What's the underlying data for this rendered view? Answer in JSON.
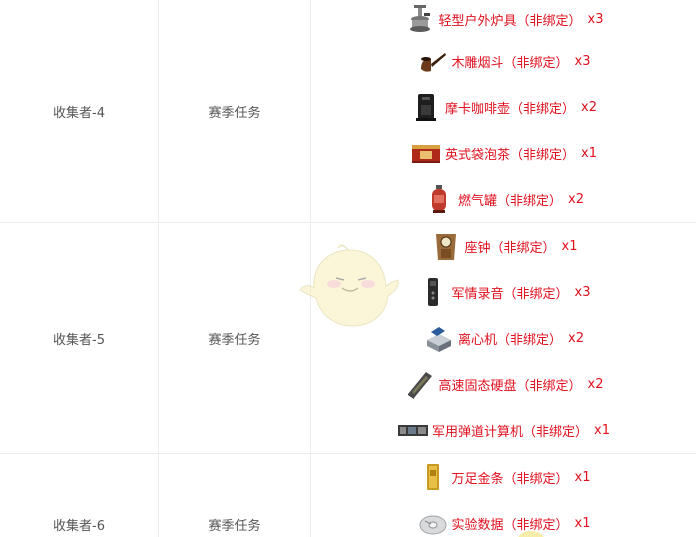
{
  "rows": [
    {
      "name": "收集者-4",
      "type": "赛季任务",
      "rewards": [
        {
          "item": "轻型户外炉具（非绑定）",
          "qty": "x3",
          "icon": "camping-stove-icon"
        },
        {
          "item": "木雕烟斗（非绑定）",
          "qty": "x3",
          "icon": "pipe-icon"
        },
        {
          "item": "摩卡咖啡壶（非绑定）",
          "qty": "x2",
          "icon": "coffee-maker-icon"
        },
        {
          "item": "英式袋泡茶（非绑定）",
          "qty": "x1",
          "icon": "tea-box-icon"
        },
        {
          "item": "燃气罐（非绑定）",
          "qty": "x2",
          "icon": "gas-tank-icon"
        }
      ]
    },
    {
      "name": "收集者-5",
      "type": "赛季任务",
      "rewards": [
        {
          "item": "座钟（非绑定）",
          "qty": "x1",
          "icon": "mantel-clock-icon"
        },
        {
          "item": "军情录音（非绑定）",
          "qty": "x3",
          "icon": "voice-recorder-icon"
        },
        {
          "item": "离心机（非绑定）",
          "qty": "x2",
          "icon": "centrifuge-icon"
        },
        {
          "item": "高速固态硬盘（非绑定）",
          "qty": "x2",
          "icon": "ssd-icon"
        },
        {
          "item": "军用弹道计算机（非绑定）",
          "qty": "x1",
          "icon": "ballistic-computer-icon"
        }
      ]
    },
    {
      "name": "收集者-6",
      "type": "赛季任务",
      "rewards": [
        {
          "item": "万足金条（非绑定）",
          "qty": "x1",
          "icon": "gold-bar-icon"
        },
        {
          "item": "实验数据（非绑定）",
          "qty": "x1",
          "icon": "data-disc-icon"
        }
      ]
    }
  ],
  "colors": {
    "reward_text": "#e0101e",
    "cell_text": "#555555",
    "border": "#ebebeb"
  }
}
